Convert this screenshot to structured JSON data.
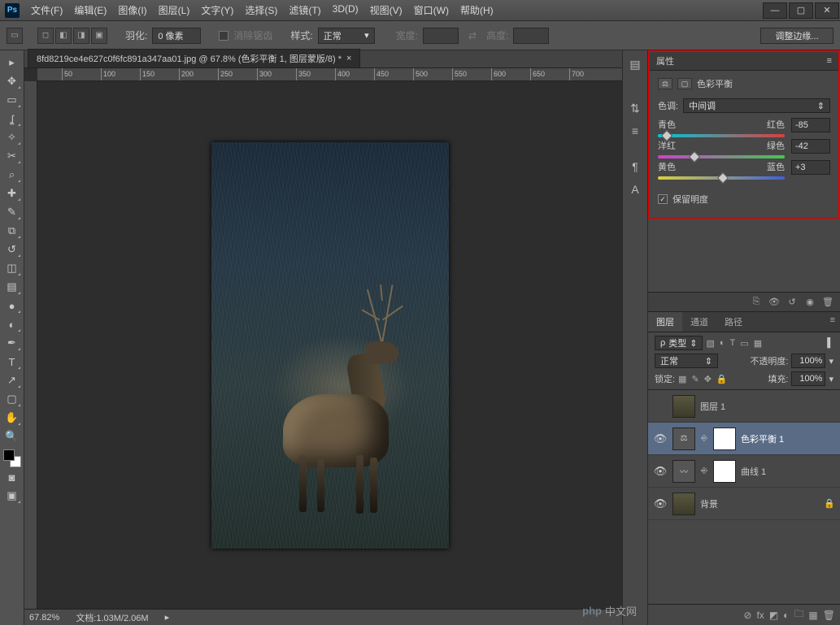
{
  "menubar": {
    "items": [
      "文件(F)",
      "编辑(E)",
      "图像(I)",
      "图层(L)",
      "文字(Y)",
      "选择(S)",
      "滤镜(T)",
      "3D(D)",
      "视图(V)",
      "窗口(W)",
      "帮助(H)"
    ]
  },
  "options": {
    "feather_label": "羽化:",
    "feather_value": "0 像素",
    "antialias_label": "消除锯齿",
    "style_label": "样式:",
    "style_value": "正常",
    "width_label": "宽度:",
    "height_label": "高度:",
    "refine_label": "调整边缘..."
  },
  "doc_tab": {
    "title": "8fd8219ce4e627c0f6fc891a347aa01.jpg @ 67.8% (色彩平衡 1, 图层蒙版/8) *"
  },
  "ruler_ticks": [
    "50",
    "100",
    "150",
    "200",
    "250",
    "300",
    "350",
    "400",
    "450",
    "500",
    "550",
    "600",
    "650",
    "700"
  ],
  "status": {
    "zoom": "67.82%",
    "doc_label": "文档:",
    "doc_value": "1.03M/2.06M"
  },
  "properties": {
    "panel_title": "属性",
    "adjustment_name": "色彩平衡",
    "tone_label": "色调:",
    "tone_value": "中间调",
    "sliders": [
      {
        "left": "青色",
        "right": "红色",
        "value": "-85",
        "pct": 7
      },
      {
        "left": "洋红",
        "right": "绿色",
        "value": "-42",
        "pct": 29
      },
      {
        "left": "黄色",
        "right": "蓝色",
        "value": "+3",
        "pct": 51
      }
    ],
    "preserve_label": "保留明度"
  },
  "layers_panel": {
    "tabs": [
      "图层",
      "通道",
      "路径"
    ],
    "kind_label": "类型",
    "blend_value": "正常",
    "opacity_label": "不透明度:",
    "opacity_value": "100%",
    "lock_label": "锁定:",
    "fill_label": "填充:",
    "fill_value": "100%",
    "layers": [
      {
        "visible": false,
        "type": "image",
        "name": "图层 1",
        "selected": false
      },
      {
        "visible": true,
        "type": "adj-bal",
        "name": "色彩平衡 1",
        "selected": true
      },
      {
        "visible": true,
        "type": "adj-curve",
        "name": "曲线 1",
        "selected": false
      },
      {
        "visible": true,
        "type": "bg",
        "name": "背景",
        "selected": false,
        "locked": true
      }
    ]
  },
  "watermark": {
    "brand": "php",
    "text": "中文网"
  }
}
